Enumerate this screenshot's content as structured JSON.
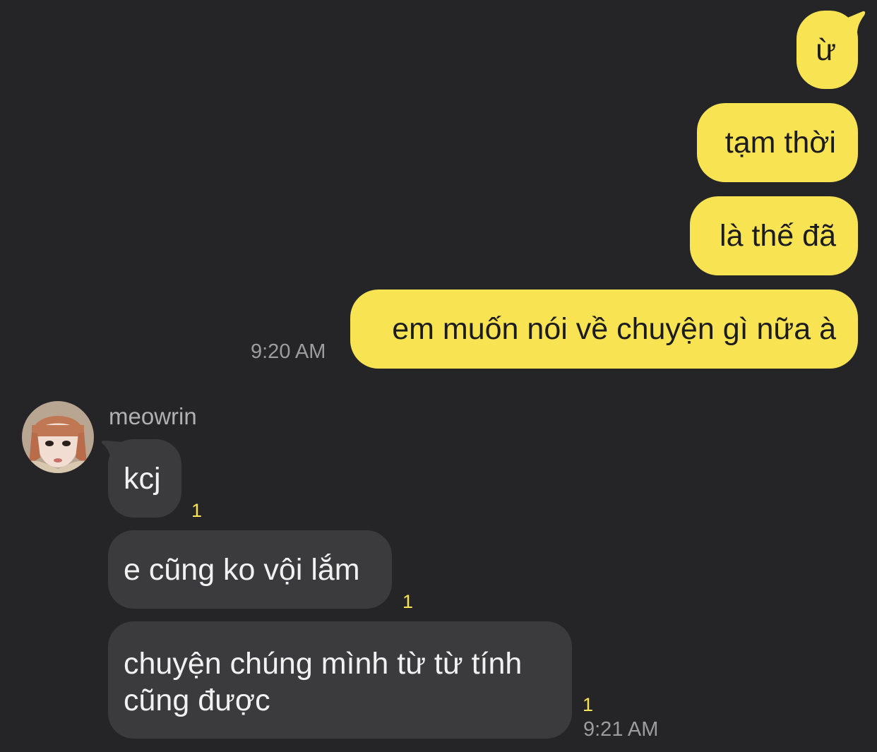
{
  "conversation": {
    "outgoing": [
      {
        "text": "ừ"
      },
      {
        "text": "tạm thời"
      },
      {
        "text": "là thế đã"
      },
      {
        "text": "em muốn nói về chuyện gì nữa à"
      }
    ],
    "outgoing_time": "9:20 AM",
    "sender_name": "meowrin",
    "incoming": [
      {
        "text": "kcj",
        "unread": "1"
      },
      {
        "text": "e cũng ko vội lắm",
        "unread": "1"
      },
      {
        "text": "chuyện chúng mình từ từ tính cũng được",
        "unread": "1"
      }
    ],
    "incoming_time": "9:21 AM"
  },
  "colors": {
    "background": "#252527",
    "outgoing_bubble": "#f8e352",
    "incoming_bubble": "#3b3b3e",
    "unread_count": "#f8e352"
  }
}
